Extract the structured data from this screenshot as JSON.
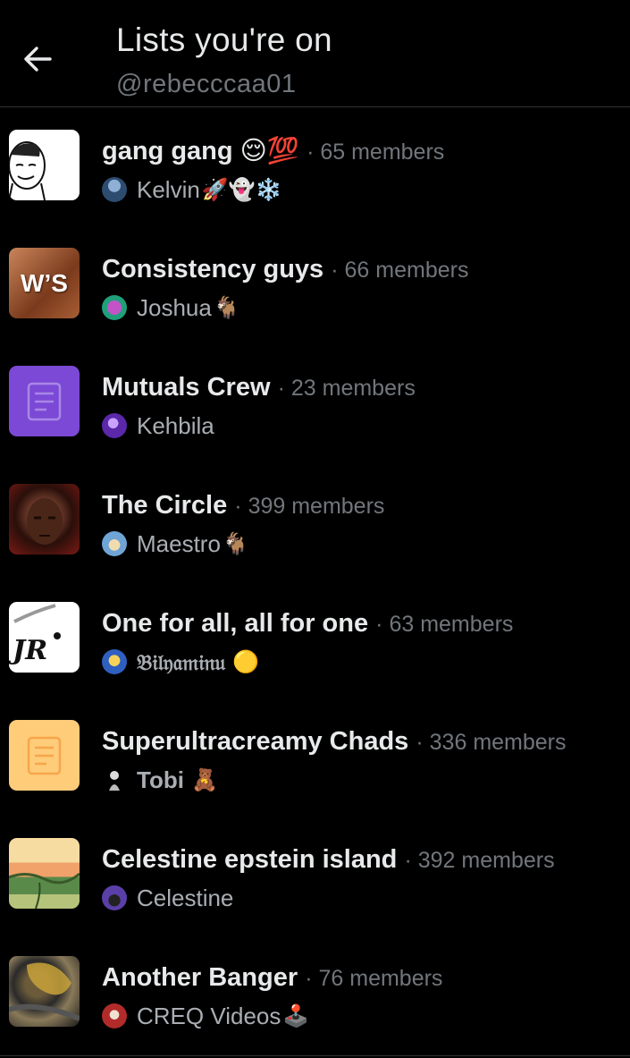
{
  "header": {
    "title": "Lists you're on",
    "handle": "@rebecccaa01"
  },
  "member_suffix": "members",
  "lists": [
    {
      "name": "gang gang 😌💯",
      "members": "65 members",
      "owner": "Kelvin",
      "owner_emoji": "🚀👻❄️",
      "thumb": "sketch-face",
      "avatar_color": "#4a6a8a"
    },
    {
      "name": "Consistency guys",
      "members": "66 members",
      "owner": "Joshua",
      "owner_emoji": "🐐",
      "thumb": "ws-logo",
      "avatar_color": "#2aa37a"
    },
    {
      "name": "Mutuals Crew",
      "members": "23 members",
      "owner": "Kehbila",
      "owner_emoji": "",
      "thumb": "default-list-purple",
      "avatar_color": "#6a3bbf"
    },
    {
      "name": "The Circle",
      "members": "399 members",
      "owner": "Maestro",
      "owner_emoji": "🐐",
      "thumb": "portrait-red",
      "avatar_color": "#d8c48a"
    },
    {
      "name": "One for all, all for one",
      "members": "63 members",
      "owner": "𝔅𝔦𝔩𝔶𝔞𝔪𝔦𝔫𝔲",
      "owner_emoji": "🟡",
      "thumb": "jr-logo",
      "avatar_color": "#3b6fd1"
    },
    {
      "name": "Superultracreamy Chads",
      "members": "336 members",
      "owner": "Tobi",
      "owner_emoji": "🧸",
      "thumb": "default-list-yellow",
      "avatar_color": "#cfcfcf"
    },
    {
      "name": "Celestine epstein island",
      "members": "392 members",
      "owner": "Celestine",
      "owner_emoji": "",
      "thumb": "landscape",
      "avatar_color": "#5b3fa8"
    },
    {
      "name": "Another Banger",
      "members": "76 members",
      "owner": "CREQ Videos",
      "owner_emoji": "🕹️",
      "thumb": "gold-texture",
      "avatar_color": "#b22b2b"
    }
  ]
}
